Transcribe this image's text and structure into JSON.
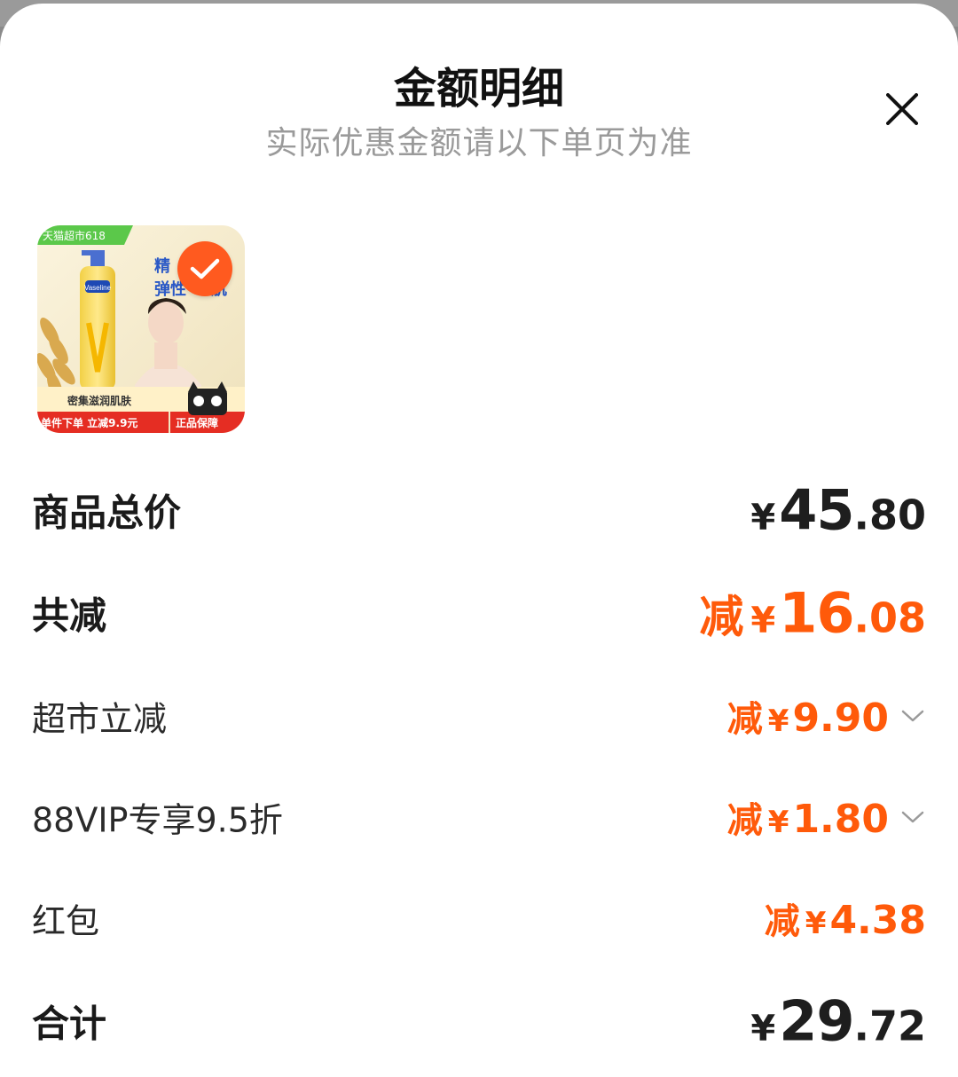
{
  "header": {
    "title": "金额明细",
    "subtitle": "实际优惠金额请以下单页为准"
  },
  "product": {
    "selected": true,
    "image": {
      "corner_tag": "天猫超市618",
      "headline_1": "精",
      "headline_2": "弹性",
      "headline_3": "肌",
      "tagline": "密集滋润肌肤",
      "promo_left": "单件下单 立减9.9元",
      "promo_right": "正品保障",
      "brand": "Vaseline"
    }
  },
  "summary": {
    "goods_total": {
      "label": "商品总价",
      "currency": "¥",
      "integer": "45",
      "decimal": ".80"
    },
    "total_discount": {
      "label": "共减",
      "prefix": "减",
      "currency": "¥",
      "integer": "16",
      "decimal": ".08"
    },
    "discounts": [
      {
        "label": "超市立减",
        "prefix": "减",
        "currency": "¥",
        "amount": "9.90",
        "expandable": true
      },
      {
        "label": "88VIP专享9.5折",
        "prefix": "减",
        "currency": "¥",
        "amount": "1.80",
        "expandable": true
      },
      {
        "label": "红包",
        "prefix": "减",
        "currency": "¥",
        "amount": "4.38",
        "expandable": false
      }
    ],
    "grand_total": {
      "label": "合计",
      "currency": "¥",
      "integer": "29",
      "decimal": ".72"
    }
  },
  "colors": {
    "accent": "#ff5a0a",
    "badge": "#ff5a1f",
    "text_primary": "#1e1e1e",
    "text_muted": "#9a9a9a"
  },
  "icons": [
    "close-icon",
    "check-icon",
    "chevron-down-icon"
  ]
}
